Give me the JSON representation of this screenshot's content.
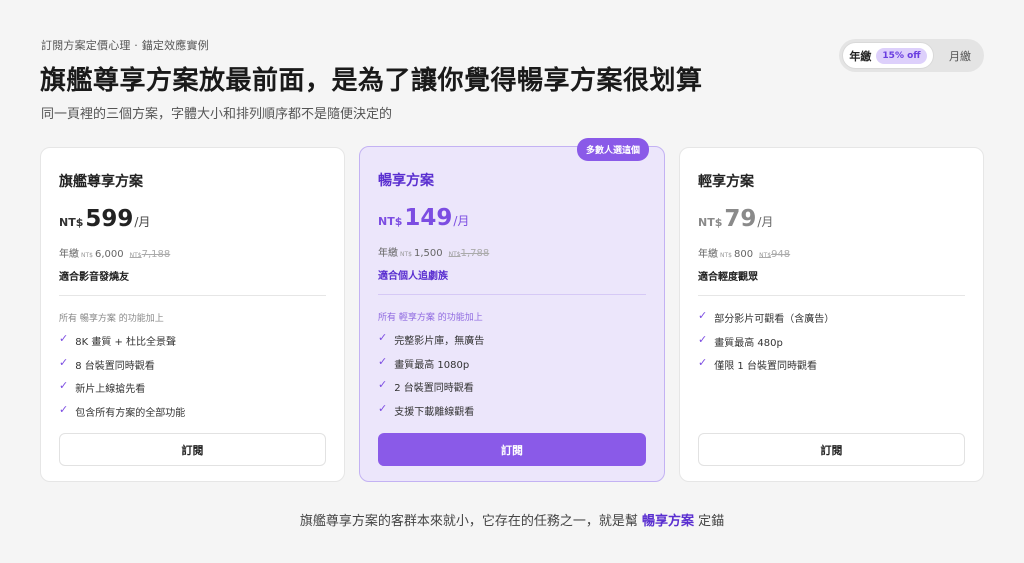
{
  "header": {
    "eyebrow": "訂閱方案定價心理 · 錨定效應實例",
    "title": "旗艦尊享方案放最前面，是為了讓你覺得暢享方案很划算",
    "subtitle": "同一頁裡的三個方案，字體大小和排列順序都不是隨便決定的"
  },
  "billing_toggle": {
    "yearly_label": "年繳",
    "discount": "15% off",
    "monthly_label": "月繳",
    "selected": "yearly"
  },
  "plans": [
    {
      "name": "旗艦尊享方案",
      "currency": "NT$",
      "amount": "599",
      "per": "/月",
      "yearly_prefix": "年繳",
      "yearly_currency": "NT$",
      "yearly_price": "6,000",
      "yearly_orig_currency": "NT$",
      "yearly_orig_price": "7,188",
      "audience": "適合影音發燒友",
      "includes_note": "所有 暢享方案 的功能加上",
      "features": [
        "8K 畫質 + 杜比全景聲",
        "8 台裝置同時觀看",
        "新片上線搶先看",
        "包含所有方案的全部功能"
      ],
      "cta": "訂閱"
    },
    {
      "name": "暢享方案",
      "badge": "多數人選這個",
      "currency": "NT$",
      "amount": "149",
      "per": "/月",
      "yearly_prefix": "年繳",
      "yearly_currency": "NT$",
      "yearly_price": "1,500",
      "yearly_orig_currency": "NT$",
      "yearly_orig_price": "1,788",
      "audience": "適合個人追劇族",
      "includes_note": "所有 輕享方案 的功能加上",
      "features": [
        "完整影片庫，無廣告",
        "畫質最高 1080p",
        "2 台裝置同時觀看",
        "支援下載離線觀看"
      ],
      "cta": "訂閱"
    },
    {
      "name": "輕享方案",
      "currency": "NT$",
      "amount": "79",
      "per": "/月",
      "yearly_prefix": "年繳",
      "yearly_currency": "NT$",
      "yearly_price": "800",
      "yearly_orig_currency": "NT$",
      "yearly_orig_price": "948",
      "audience": "適合輕度觀眾",
      "features": [
        "部分影片可觀看（含廣告）",
        "畫質最高 480p",
        "僅限 1 台裝置同時觀看"
      ],
      "cta": "訂閱"
    }
  ],
  "check_glyph": "✓",
  "footer": {
    "before": "旗艦尊享方案的客群本來就小，它存在的任務之一，就是幫",
    "highlight": "暢享方案",
    "after": "定錨"
  },
  "colors": {
    "accent": "#8a5ae8",
    "accent_dark": "#5a2fd0",
    "highlight_card_bg": "#ece6fb",
    "page_bg": "#f5f5f5"
  }
}
